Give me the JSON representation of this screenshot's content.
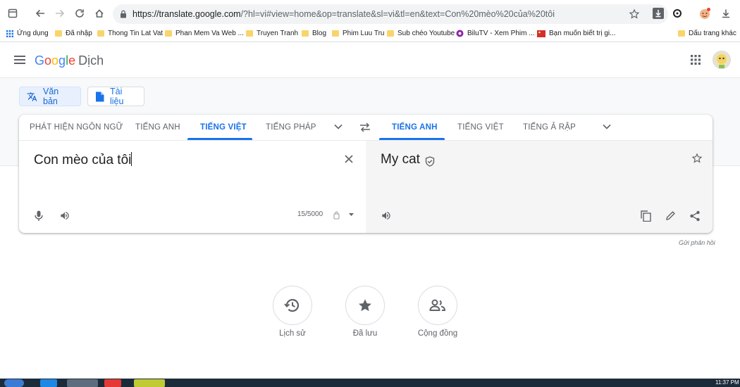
{
  "browser": {
    "url_host": "https://translate.google.com",
    "url_rest": "/?hl=vi#view=home&op=translate&sl=vi&tl=en&text=Con%20mèo%20của%20tôi"
  },
  "bookmarks": {
    "items": [
      {
        "label": "Ứng dụng",
        "icon": "apps-grid"
      },
      {
        "label": "Đã nhập",
        "icon": "folder"
      },
      {
        "label": "Thong Tin Lat Vat",
        "icon": "folder"
      },
      {
        "label": "Phan Mem Va Web ...",
        "icon": "folder"
      },
      {
        "label": "Truyen Tranh",
        "icon": "folder"
      },
      {
        "label": "Blog",
        "icon": "folder"
      },
      {
        "label": "Phim Luu Tru",
        "icon": "folder"
      },
      {
        "label": "Sub chéo Youtube",
        "icon": "folder"
      },
      {
        "label": "BiluTV - Xem Phim ...",
        "icon": "bilutv"
      },
      {
        "label": "Bạn muốn biết trị gi...",
        "icon": "red-flag"
      }
    ],
    "other": "Dấu trang khác"
  },
  "app": {
    "logo": {
      "g1": "G",
      "g2": "o",
      "g3": "o",
      "g4": "g",
      "g5": "l",
      "g6": "e",
      "product": "Dịch"
    }
  },
  "modes": {
    "text": "Văn bản",
    "documents": "Tài liệu"
  },
  "source_langs": [
    "PHÁT HIỆN NGÔN NGỮ",
    "TIẾNG ANH",
    "TIẾNG VIỆT",
    "TIẾNG PHÁP"
  ],
  "target_langs": [
    "TIẾNG ANH",
    "TIẾNG VIỆT",
    "TIẾNG Ả RẬP"
  ],
  "source": {
    "text": "Con mèo của tôi",
    "char_count": "15/5000"
  },
  "target": {
    "text": "My cat"
  },
  "feedback": "Gửi phản hồi",
  "bottom": {
    "history": "Lịch sử",
    "saved": "Đã lưu",
    "community": "Cộng đồng"
  },
  "taskbar": {
    "clock": "11:37 PM"
  },
  "colors": {
    "accent": "#1a73e8",
    "target_bg": "#f5f5f5"
  }
}
